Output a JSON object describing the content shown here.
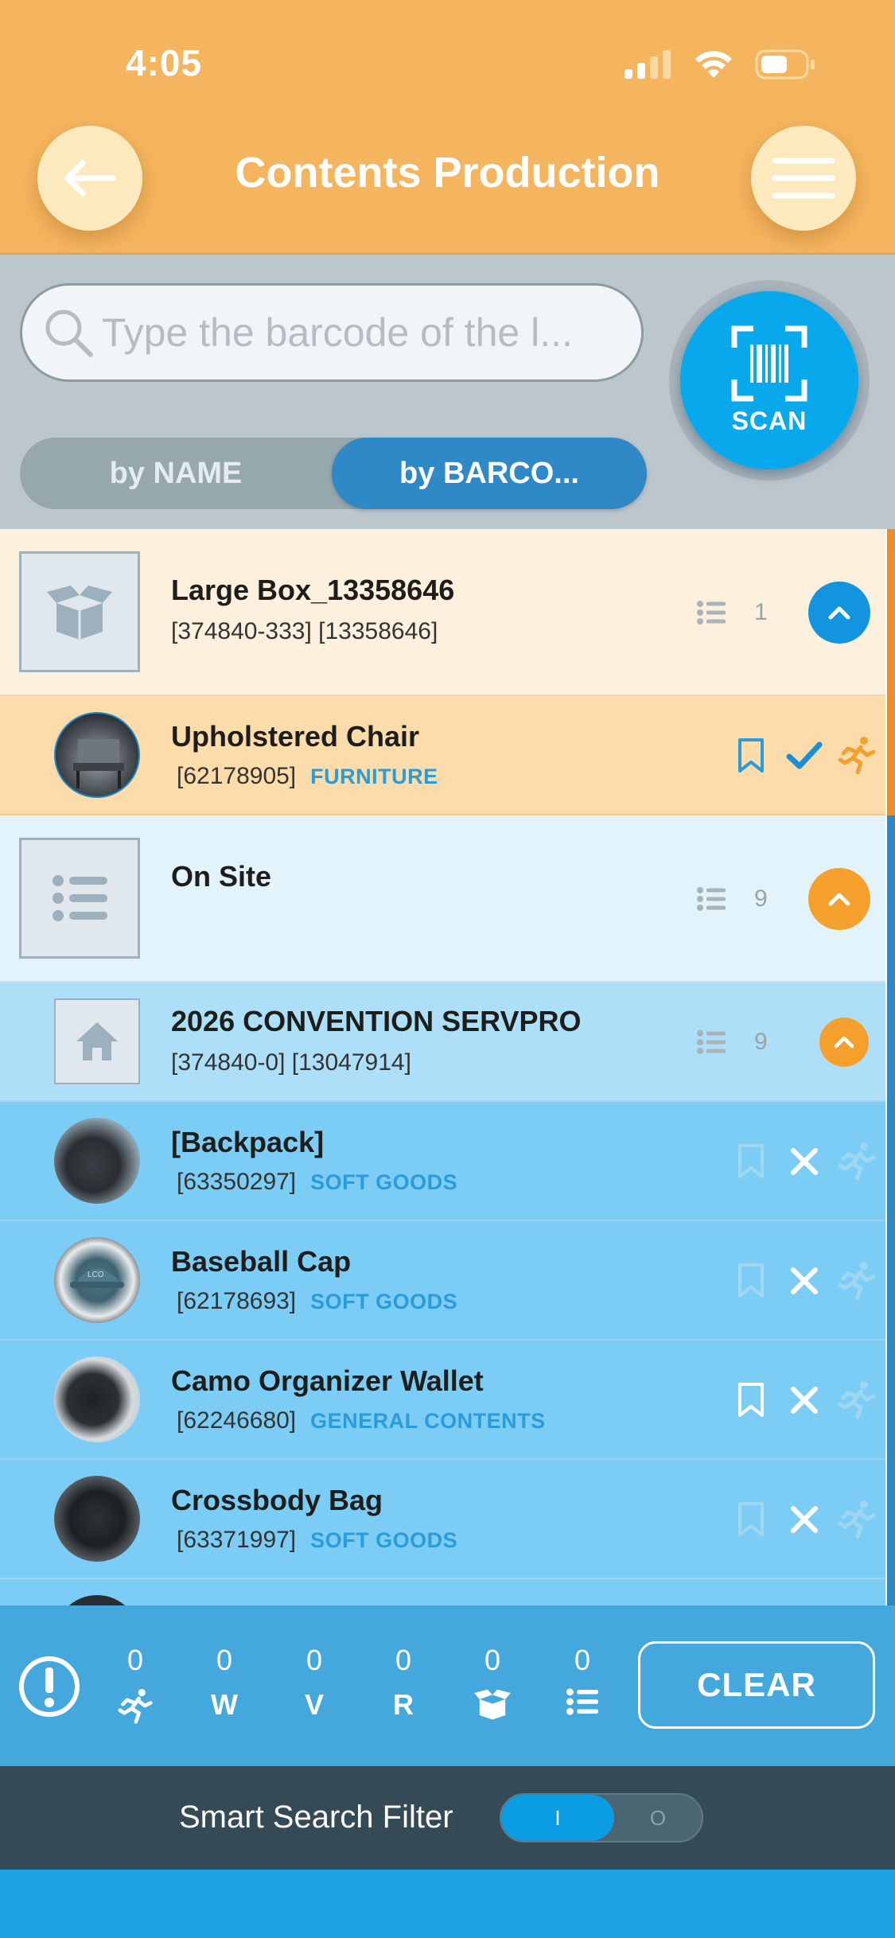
{
  "status_bar": {
    "time": "4:05"
  },
  "header": {
    "title": "Contents Production"
  },
  "search": {
    "placeholder": "Type the barcode of the l...",
    "scan_label": "SCAN"
  },
  "filter_tabs": [
    {
      "label": "by NAME",
      "active": false
    },
    {
      "label": "by BARCO...",
      "active": true
    }
  ],
  "list": {
    "box_group": {
      "title": "Large Box_13358646",
      "subtitle": "[374840-333] [13358646]",
      "count": "1"
    },
    "chair": {
      "title": "Upholstered Chair",
      "code": "[62178905]",
      "category": "FURNITURE"
    },
    "onsite_group": {
      "title": "On Site",
      "count": "9"
    },
    "convention": {
      "title": "2026 CONVENTION SERVPRO",
      "subtitle": "[374840-0] [13047914]",
      "count": "9"
    },
    "items": [
      {
        "title": "[Backpack]",
        "code": "[63350297]",
        "category": "SOFT GOODS",
        "bookmark_active": false
      },
      {
        "title": "Baseball Cap",
        "code": "[62178693]",
        "category": "SOFT GOODS",
        "bookmark_active": false
      },
      {
        "title": "Camo Organizer Wallet",
        "code": "[62246680]",
        "category": "GENERAL CONTENTS",
        "bookmark_active": true
      },
      {
        "title": "Crossbody Bag",
        "code": "[63371997]",
        "category": "SOFT GOODS",
        "bookmark_active": false
      }
    ]
  },
  "counters": [
    {
      "value": "0",
      "icon": "runner-icon"
    },
    {
      "value": "0",
      "label": "W"
    },
    {
      "value": "0",
      "label": "V"
    },
    {
      "value": "0",
      "label": "R"
    },
    {
      "value": "0",
      "icon": "open-box-icon"
    },
    {
      "value": "0",
      "icon": "list-icon"
    }
  ],
  "clear_label": "CLEAR",
  "smart_search": {
    "label": "Smart Search Filter",
    "on_label": "I",
    "off_label": "O",
    "enabled": true
  },
  "colors": {
    "header": "#f5b55e",
    "accent_blue": "#08a9ec",
    "accent_orange": "#f5a02c",
    "category_blue": "#2b9bd9",
    "row_blue": "#7ccdf5"
  }
}
